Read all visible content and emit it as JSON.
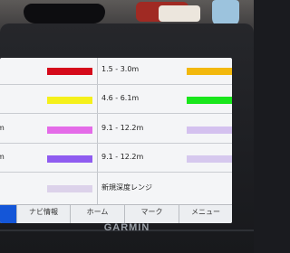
{
  "depth_table": {
    "rows": [
      {
        "left_label": "",
        "left_color": "#d50a1b",
        "right_label": "1.5 - 3.0m",
        "right_color": "#f2b80d"
      },
      {
        "left_label": "",
        "left_color": "#f5f01b",
        "right_label": "4.6 - 6.1m",
        "right_color": "#19e61c"
      },
      {
        "left_label": "m",
        "left_color": "#e46be8",
        "right_label": "9.1 - 12.2m",
        "right_color": "#d4c1ef"
      },
      {
        "left_label": "m",
        "left_color": "#8f5cf0",
        "right_label": "9.1 - 12.2m",
        "right_color": "#d6c8ee"
      },
      {
        "left_label": "",
        "left_color": "#dcd2ea",
        "right_label": "新規深度レンジ",
        "right_color": ""
      }
    ]
  },
  "softkeys": [
    {
      "label": "",
      "active": true
    },
    {
      "label": "ナビ情報",
      "active": false
    },
    {
      "label": "ホーム",
      "active": false
    },
    {
      "label": "マーク",
      "active": false
    },
    {
      "label": "メニュー",
      "active": false
    }
  ],
  "brand": "GARMIN"
}
